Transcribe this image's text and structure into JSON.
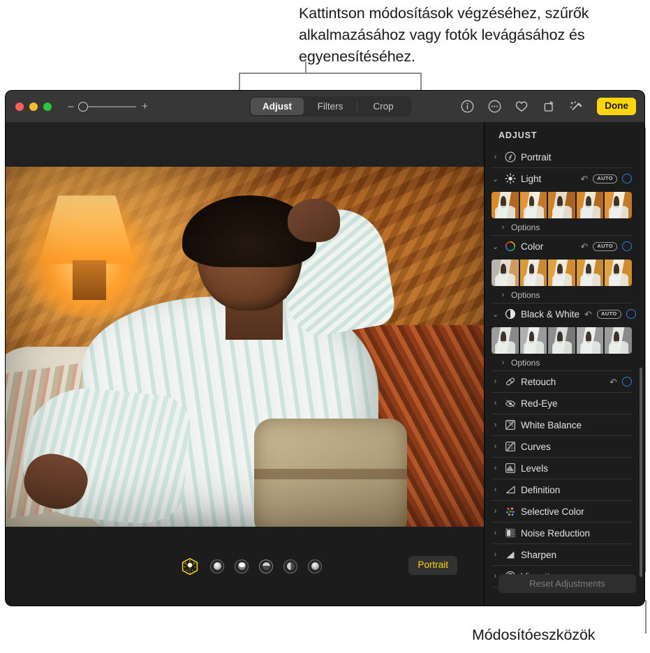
{
  "callouts": {
    "top": "Kattintson módosítások végzéséhez, szűrők alkalmazásához vagy fotók levágásához és egyenesítéséhez.",
    "bottom": "Módosítóeszközök"
  },
  "toolbar": {
    "window_buttons": [
      "close-button",
      "minimize-button",
      "zoom-button"
    ],
    "zoom": {
      "minus": "–",
      "plus": "+",
      "value": "0"
    },
    "segments": [
      {
        "label": "Adjust",
        "active": true
      },
      {
        "label": "Filters",
        "active": false
      },
      {
        "label": "Crop",
        "active": false
      }
    ],
    "icons": [
      "info-icon",
      "more-options-icon",
      "favorite-heart-icon",
      "rotate-icon",
      "enhance-wand-icon"
    ],
    "done_label": "Done"
  },
  "bottom_bar": {
    "lighting_effects": [
      "natural-light-cube",
      "studio-light",
      "contour-light",
      "stage-light",
      "stage-light-mono",
      "high-key-light"
    ],
    "mode_label": "Portrait"
  },
  "sidebar": {
    "title": "ADJUST",
    "auto_label": "AUTO",
    "options_label": "Options",
    "reset_label": "Reset Adjustments",
    "items": [
      {
        "label": "Portrait",
        "icon": "portrait-f-icon",
        "expanded": false,
        "has_undo": false,
        "has_auto": false,
        "has_knob": false,
        "has_thumbs": false,
        "has_options": false
      },
      {
        "label": "Light",
        "icon": "sun-icon",
        "expanded": true,
        "has_undo": true,
        "has_auto": true,
        "has_knob": true,
        "has_thumbs": true,
        "has_options": true
      },
      {
        "label": "Color",
        "icon": "color-wheel-icon",
        "expanded": true,
        "has_undo": true,
        "has_auto": true,
        "has_knob": true,
        "has_thumbs": true,
        "has_options": true
      },
      {
        "label": "Black & White",
        "icon": "contrast-circle-icon",
        "expanded": true,
        "has_undo": true,
        "has_auto": true,
        "has_knob": true,
        "has_thumbs": true,
        "has_options": true
      },
      {
        "label": "Retouch",
        "icon": "retouch-bandage-icon",
        "expanded": false,
        "has_undo": true,
        "has_auto": false,
        "has_knob": true,
        "has_thumbs": false,
        "has_options": false
      },
      {
        "label": "Red-Eye",
        "icon": "red-eye-icon",
        "expanded": false,
        "has_undo": false,
        "has_auto": false,
        "has_knob": false,
        "has_thumbs": false,
        "has_options": false
      },
      {
        "label": "White Balance",
        "icon": "white-balance-icon",
        "expanded": false,
        "has_undo": false,
        "has_auto": false,
        "has_knob": false,
        "has_thumbs": false,
        "has_options": false
      },
      {
        "label": "Curves",
        "icon": "curves-icon",
        "expanded": false,
        "has_undo": false,
        "has_auto": false,
        "has_knob": false,
        "has_thumbs": false,
        "has_options": false
      },
      {
        "label": "Levels",
        "icon": "levels-icon",
        "expanded": false,
        "has_undo": false,
        "has_auto": false,
        "has_knob": false,
        "has_thumbs": false,
        "has_options": false
      },
      {
        "label": "Definition",
        "icon": "definition-icon",
        "expanded": false,
        "has_undo": false,
        "has_auto": false,
        "has_knob": false,
        "has_thumbs": false,
        "has_options": false
      },
      {
        "label": "Selective Color",
        "icon": "selective-color-icon",
        "expanded": false,
        "has_undo": false,
        "has_auto": false,
        "has_knob": false,
        "has_thumbs": false,
        "has_options": false
      },
      {
        "label": "Noise Reduction",
        "icon": "noise-reduction-icon",
        "expanded": false,
        "has_undo": false,
        "has_auto": false,
        "has_knob": false,
        "has_thumbs": false,
        "has_options": false
      },
      {
        "label": "Sharpen",
        "icon": "sharpen-icon",
        "expanded": false,
        "has_undo": false,
        "has_auto": false,
        "has_knob": false,
        "has_thumbs": false,
        "has_options": false
      },
      {
        "label": "Vignette",
        "icon": "vignette-icon",
        "expanded": false,
        "has_undo": false,
        "has_auto": false,
        "has_knob": false,
        "has_thumbs": false,
        "has_options": false
      }
    ]
  },
  "colors": {
    "accent_yellow": "#ffd60a",
    "knob_blue": "#2f7ce0",
    "toolbar_bg": "#373737",
    "window_bg": "#1c1c1c",
    "callout_line": "#8d8d8d"
  }
}
